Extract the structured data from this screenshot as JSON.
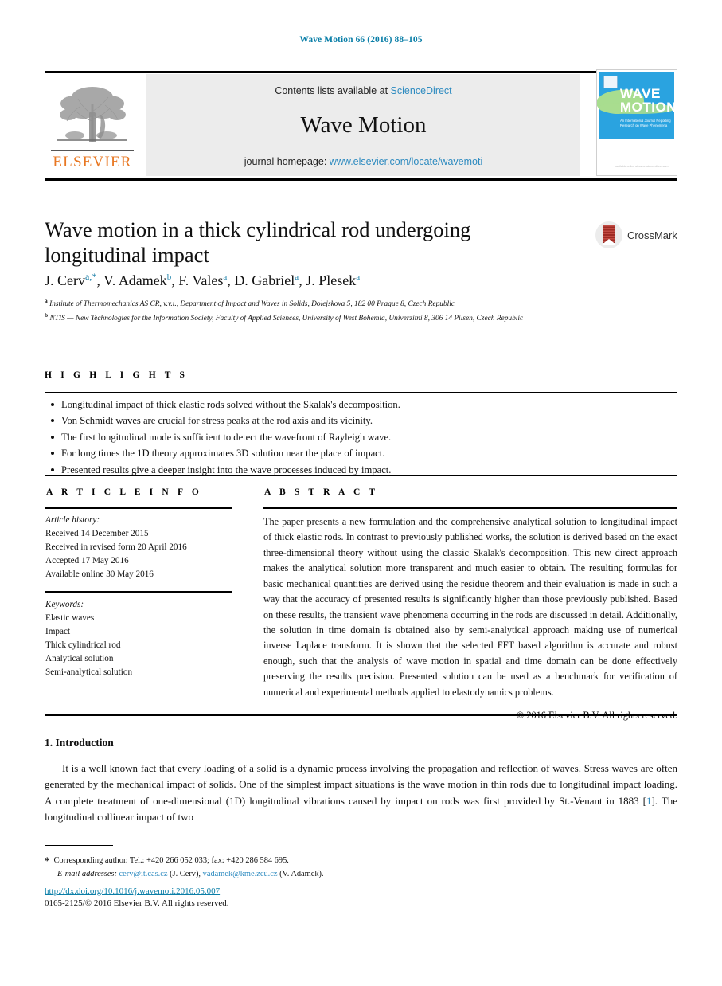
{
  "running_head": "Wave Motion 66 (2016) 88–105",
  "masthead": {
    "contents_prefix": "Contents lists available at",
    "contents_link": "ScienceDirect",
    "journal_title": "Wave Motion",
    "homepage_prefix": "journal homepage:",
    "homepage_link": "www.elsevier.com/locate/wavemoti",
    "publisher_wordmark": "ELSEVIER",
    "cover": {
      "line1": "WAVE",
      "line2": "MOTION",
      "subtitle": "An International Journal Reporting Research on Wave Phenomena",
      "footer": "available online at www.sciencedirect.com"
    }
  },
  "crossmark": {
    "label": "CrossMark"
  },
  "article": {
    "title": "Wave motion in a thick cylindrical rod undergoing longitudinal impact",
    "authors": [
      {
        "name": "J. Cerv",
        "marks": "a,*"
      },
      {
        "name": "V. Adamek",
        "marks": "b"
      },
      {
        "name": "F. Vales",
        "marks": "a"
      },
      {
        "name": "D. Gabriel",
        "marks": "a"
      },
      {
        "name": "J. Plesek",
        "marks": "a"
      }
    ],
    "affiliations": [
      {
        "mark": "a",
        "text": "Institute of Thermomechanics AS CR, v.v.i., Department of Impact and Waves in Solids, Dolejskova 5, 182 00 Prague 8, Czech Republic"
      },
      {
        "mark": "b",
        "text": "NTIS — New Technologies for the Information Society, Faculty of Applied Sciences, University of West Bohemia, Univerzitni 8, 306 14 Pilsen, Czech Republic"
      }
    ]
  },
  "highlights": {
    "label": "H I G H L I G H T S",
    "items": [
      "Longitudinal impact of thick elastic rods solved without the Skalak's decomposition.",
      "Von Schmidt waves are crucial for stress peaks at the rod axis and its vicinity.",
      "The first longitudinal mode is sufficient to detect the wavefront of Rayleigh wave.",
      "For long times the 1D theory approximates 3D solution near the place of impact.",
      "Presented results give a deeper insight into the wave processes induced by impact."
    ]
  },
  "article_info": {
    "label": "A R T I C L E    I N F O",
    "history_heading": "Article history:",
    "history": [
      "Received 14 December 2015",
      "Received in revised form 20 April 2016",
      "Accepted 17 May 2016",
      "Available online 30 May 2016"
    ],
    "keywords_heading": "Keywords:",
    "keywords": [
      "Elastic waves",
      "Impact",
      "Thick cylindrical rod",
      "Analytical solution",
      "Semi-analytical solution"
    ]
  },
  "abstract": {
    "label": "A B S T R A C T",
    "text": "The paper presents a new formulation and the comprehensive analytical solution to longitudinal impact of thick elastic rods. In contrast to previously published works, the solution is derived based on the exact three-dimensional theory without using the classic Skalak's decomposition. This new direct approach makes the analytical solution more transparent and much easier to obtain. The resulting formulas for basic mechanical quantities are derived using the residue theorem and their evaluation is made in such a way that the accuracy of presented results is significantly higher than those previously published. Based on these results, the transient wave phenomena occurring in the rods are discussed in detail. Additionally, the solution in time domain is obtained also by semi-analytical approach making use of numerical inverse Laplace transform. It is shown that the selected FFT based algorithm is accurate and robust enough, such that the analysis of wave motion in spatial and time domain can be done effectively preserving the results precision. Presented solution can be used as a benchmark for verification of numerical and experimental methods applied to elastodynamics problems.",
    "copyright": "© 2016 Elsevier B.V. All rights reserved."
  },
  "introduction": {
    "heading": "1. Introduction",
    "paragraph_part1": "It is a well known fact that every loading of a solid is a dynamic process involving the propagation and reflection of waves. Stress waves are often generated by the mechanical impact of solids. One of the simplest impact situations is the wave motion in thin rods due to longitudinal impact loading. A complete treatment of one-dimensional (1D) longitudinal vibrations caused by impact on rods was first provided by St.-Venant in 1883 [",
    "reference_number": "1",
    "paragraph_part2": "]. The longitudinal collinear impact of two"
  },
  "footer": {
    "corresponding_star": "*",
    "corresponding_text": "Corresponding author. Tel.: +420 266 052 033; fax: +420 286 584 695.",
    "email_label": "E-mail addresses:",
    "email1": "cerv@it.cas.cz",
    "email1_owner": "(J. Cerv),",
    "email2": "vadamek@kme.zcu.cz",
    "email2_owner": "(V. Adamek).",
    "doi": "http://dx.doi.org/10.1016/j.wavemoti.2016.05.007",
    "issn_line": "0165-2125/© 2016 Elsevier B.V. All rights reserved."
  },
  "colors": {
    "link_blue": "#2e8bc0",
    "runhead_blue": "#0b7fa8",
    "elsevier_orange": "#E87722",
    "cover_blue": "#2aa3e0",
    "cover_green": "#a8dd8f",
    "crossmark_red": "#b5332b"
  }
}
